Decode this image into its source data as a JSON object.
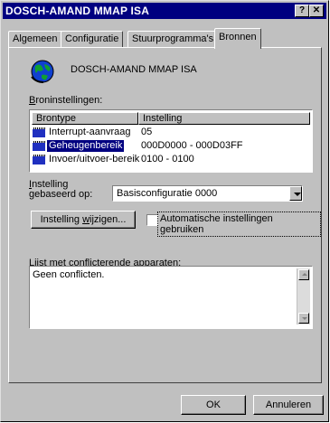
{
  "window": {
    "title": "DOSCH-AMAND MMAP ISA",
    "help_label": "?",
    "close_label": "✕"
  },
  "tabs": [
    {
      "label": "Algemeen"
    },
    {
      "label": "Configuratie"
    },
    {
      "label": "Stuurprogramma's"
    },
    {
      "label": "Bronnen",
      "active": true
    }
  ],
  "device": {
    "name": "DOSCH-AMAND MMAP ISA",
    "icon": "globe-icon"
  },
  "resources": {
    "label": "Broninstellingen:",
    "columns": [
      "Brontype",
      "Instelling"
    ],
    "rows": [
      {
        "type": "Interrupt-aanvraag",
        "value": "05",
        "selected": false
      },
      {
        "type": "Geheugenbereik",
        "value": "000D0000 - 000D03FF",
        "selected": true
      },
      {
        "type": "Invoer/uitvoer-bereik",
        "value": "0100 - 0100",
        "selected": false
      }
    ]
  },
  "setting": {
    "label_line1": "Instelling",
    "label_line2": "gebaseerd op:",
    "selected": "Basisconfiguratie 0000",
    "change_button": "Instelling wijzigen...",
    "auto_checkbox_label": "Automatische instellingen gebruiken",
    "auto_checked": false
  },
  "conflicts": {
    "label": "Lijst met conflicterende apparaten:",
    "text": "Geen conflicten."
  },
  "footer": {
    "ok_label": "OK",
    "cancel_label": "Annuleren"
  },
  "colors": {
    "titlebar": "#000080",
    "face": "#c0c0c0",
    "selection": "#000080"
  }
}
